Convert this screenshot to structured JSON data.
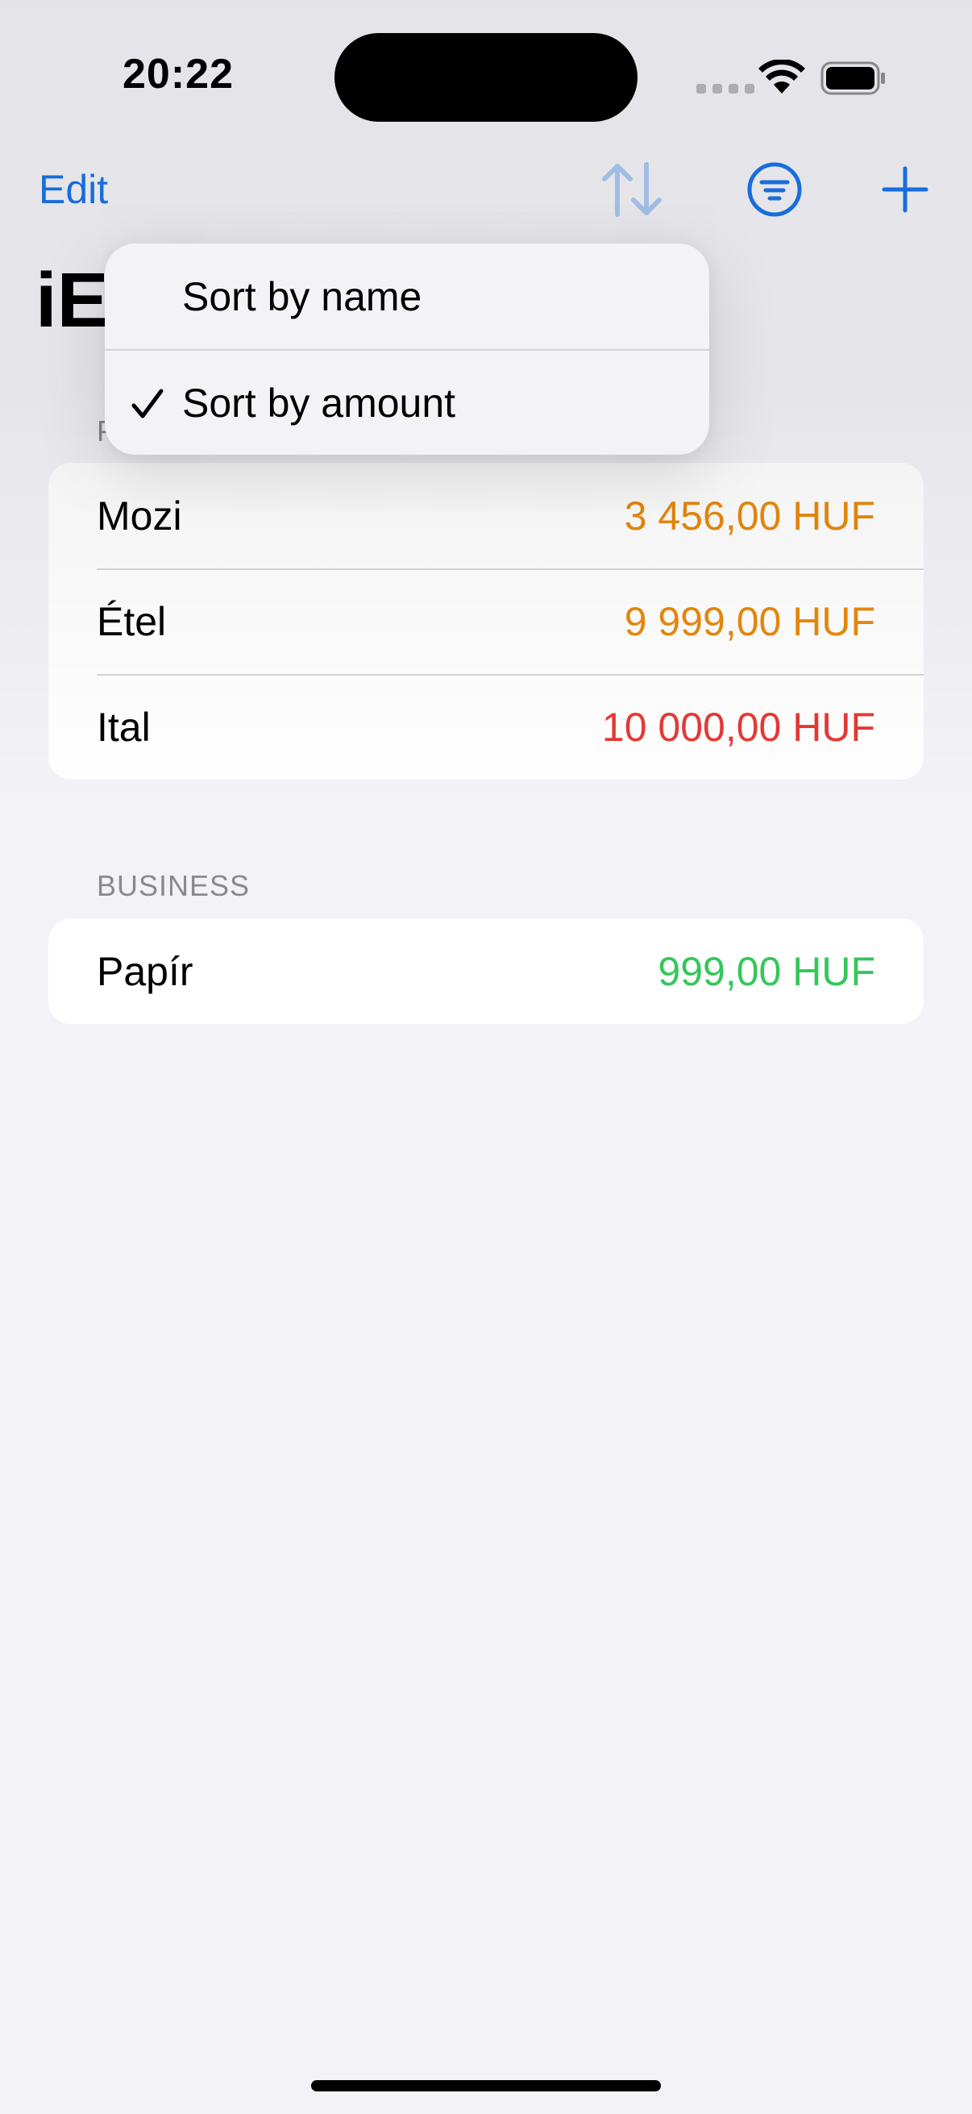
{
  "status_bar": {
    "time": "20:22"
  },
  "nav": {
    "edit_label": "Edit",
    "title": "iE"
  },
  "sort_menu": {
    "items": [
      {
        "label": "Sort by name",
        "checked": false
      },
      {
        "label": "Sort by amount",
        "checked": true
      }
    ]
  },
  "sections": [
    {
      "header": "P",
      "rows": [
        {
          "name": "Mozi",
          "amount": "3 456,00 HUF",
          "color": "#e8890c"
        },
        {
          "name": "Étel",
          "amount": "9 999,00 HUF",
          "color": "#e8890c"
        },
        {
          "name": "Ital",
          "amount": "10 000,00 HUF",
          "color": "#e53935"
        }
      ]
    },
    {
      "header": "BUSINESS",
      "rows": [
        {
          "name": "Papír",
          "amount": "999,00 HUF",
          "color": "#34c759"
        }
      ]
    }
  ],
  "colors": {
    "accent": "#1a73e8",
    "background": "#f2f2f7"
  }
}
